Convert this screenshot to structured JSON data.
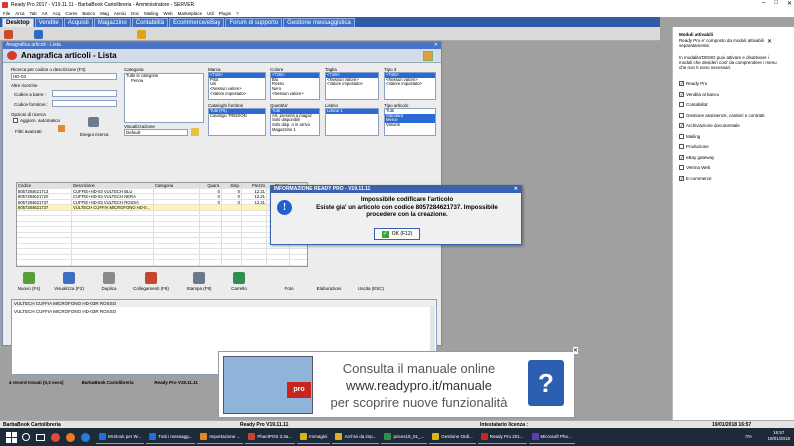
{
  "window": {
    "title": "Ready Pro 2017  -  V19.11.11  -  BarbaBook Cartolibreria  -  Amministratore  -  SERVER"
  },
  "menu": [
    "File",
    "Arca",
    "Tab",
    "Art",
    "Acq",
    "Cores",
    "Banco",
    "Mag",
    "Annici",
    "Doc",
    "Mailing",
    "Web",
    "Marketplace",
    "Util",
    "Plugin",
    "?"
  ],
  "tabs": [
    "Desktop",
    "Vendite",
    "Acquisti",
    "Magazzino",
    "Contabilità",
    "Ecommerce/eBay",
    "Forum di supporto",
    "Gestione messaggistica"
  ],
  "anagrafica": {
    "caption": "Anagrafica articoli  -  Lista",
    "title": "Anagrafica articoli  - Lista",
    "search_label": "Ricerca per codice o descrizione (F3)",
    "search_value": "HD-03",
    "altre_label": "Altre ricerche",
    "codice_a_barre": "Codice a barre :",
    "codice_fornitore": "Codice fornitore :",
    "opzioni": "Opzioni di ricerca",
    "aggiorn": "Aggiorn. automatico",
    "filtri": "Filtri avanzati",
    "esegui": "Esegui ricerca",
    "categoria_label": "Categoria",
    "categoria_items": [
      "Tutte le categorie",
      "Penna"
    ],
    "visualizzazione_label": "Visualizzazione",
    "visualizzazione_value": "Default",
    "marca_label": "Marca",
    "marca": [
      "<Tutti>",
      "Pilot",
      "Uni",
      "<Nessun valore>",
      "<Valore impostato>"
    ],
    "colore_label": "Colore",
    "colore": [
      "<Tutti>",
      "Blu",
      "Rosso",
      "Nero",
      "<Nessun valore>"
    ],
    "taglia_label": "Taglia",
    "taglia": [
      "<Tutti>",
      "<Nessun valore>",
      "<Valore impostato>"
    ],
    "tipo3_label": "Tipo 3",
    "tipo3": [
      "<Tutti>",
      "<Nessun valore>",
      "<Valore impostato>"
    ],
    "cataloghi_label": "Cataloghi fornitori",
    "cataloghi": [
      "Tutti (F5)",
      "Catalogo TREDION"
    ],
    "quantita_label": "Quantita'",
    "quantita": [
      "Tutti",
      "Art. presenti a magaz",
      "Solo disponibili",
      "Solo disp. o in arrivo",
      "Magazzino 1"
    ],
    "listino_label": "Listino",
    "listino": [
      "Listino 1"
    ],
    "tipo_articolo_label": "Tipo articolo",
    "tipo_articolo": [
      "Tutti",
      "Standard",
      "Merce",
      "Varianti"
    ],
    "columns": [
      "Codice",
      "Descrizione",
      "Categoria",
      "Quant.",
      "Disp.",
      "Prezzo",
      "Prezzo"
    ],
    "rows": [
      [
        "8057284621713",
        "CUFFIE+HD-03 VULTECH BLU",
        "",
        "0",
        "0",
        "12,21",
        "14,90"
      ],
      [
        "8057284621720",
        "CUFFIE+HD-03 VULTECH NERA",
        "",
        "0",
        "0",
        "12,21",
        "14,90"
      ],
      [
        "8057284621737",
        "CUFFIE+HD-03 VULTECH ROSSA",
        "",
        "0",
        "0",
        "12,21",
        "14,90"
      ],
      [
        "8057284621737",
        "VULTECH CUFFIA MICROFONO HD-0...",
        "",
        "",
        "",
        "",
        ""
      ]
    ],
    "buttons": [
      "Nuovo (F4)",
      "Visualizza (F2)",
      "Duplica",
      "Collegamenti (F8)",
      "Stampa (F9)",
      "Carrello",
      "Foto",
      "Elaborazioni",
      "Uscita (ESC)"
    ],
    "notes_title": "VULTECH CUFFIA MICROFONO HD-03R ROSSO",
    "notes_text": "VULTECH CUFFIA MICROFONO HD-03R ROSSO",
    "status": [
      "4 record trovati (0,3 secs)",
      "BarbaBook Cartolibreria",
      "Ready Pro V19.11.11",
      "Intestatario licenza :",
      "19/01/2018",
      "16:57"
    ]
  },
  "dialog": {
    "caption": "INFORMAZIONE READY PRO - V19.11.11",
    "line1": "Impossibile codificare l'articolo",
    "line2": "Esiste gia' un articolo con codice 8057284621737. Impossibile",
    "line3": "procedere con la creazione.",
    "ok": "OK (F12)"
  },
  "right_panel": {
    "title": "Moduli attivabili",
    "desc1": "Ready Pro e' composto da moduli attivabili separatamente.",
    "desc2": "In modalita'DEMO puoi attivare e disattivare i moduli che desideri cosi' da comprendere i menu che non ti sono necessari.",
    "options": [
      {
        "label": "Ready Pro",
        "checked": true
      },
      {
        "label": "Vendita al banco",
        "checked": true
      },
      {
        "label": "Contabilita'",
        "checked": false
      },
      {
        "label": "Gestione assistenze, cantieri e contratti",
        "checked": false
      },
      {
        "label": "Archiviazione documentale",
        "checked": true
      },
      {
        "label": "Mailing",
        "checked": false
      },
      {
        "label": "Produzione",
        "checked": false
      },
      {
        "label": "eBay gateway",
        "checked": true
      },
      {
        "label": "Vetrina Web",
        "checked": false
      },
      {
        "label": "E-commerce",
        "checked": true
      }
    ]
  },
  "banner": {
    "line1": "Consulta il manuale online",
    "line2": "www.readypro.it/manuale",
    "line3": "per scoprire nuove funzionalità",
    "logo": "pro"
  },
  "bottom_status": [
    "BarbaBook Cartolibreria",
    "Ready Pro V19.11.11",
    "Intestatario licenza :",
    "19/01/2018  16:57"
  ],
  "taskbar": {
    "items": [
      "Mr.Book per W...",
      "Tutti i messagg...",
      "Importazione ...",
      "PhactPOS 3.3a...",
      "Immagini",
      "Archivi da imp...",
      "prices19_01_...",
      "Gestione Ordi...",
      "Ready Pro 201...",
      "Microsoft Pho..."
    ],
    "lang": "ITA",
    "time": "16:57",
    "date": "19/01/2018"
  },
  "colors": {
    "tab_blue": "#2f5aa6",
    "accent": "#3a62b0",
    "taskbar": "#1c2a3a"
  }
}
